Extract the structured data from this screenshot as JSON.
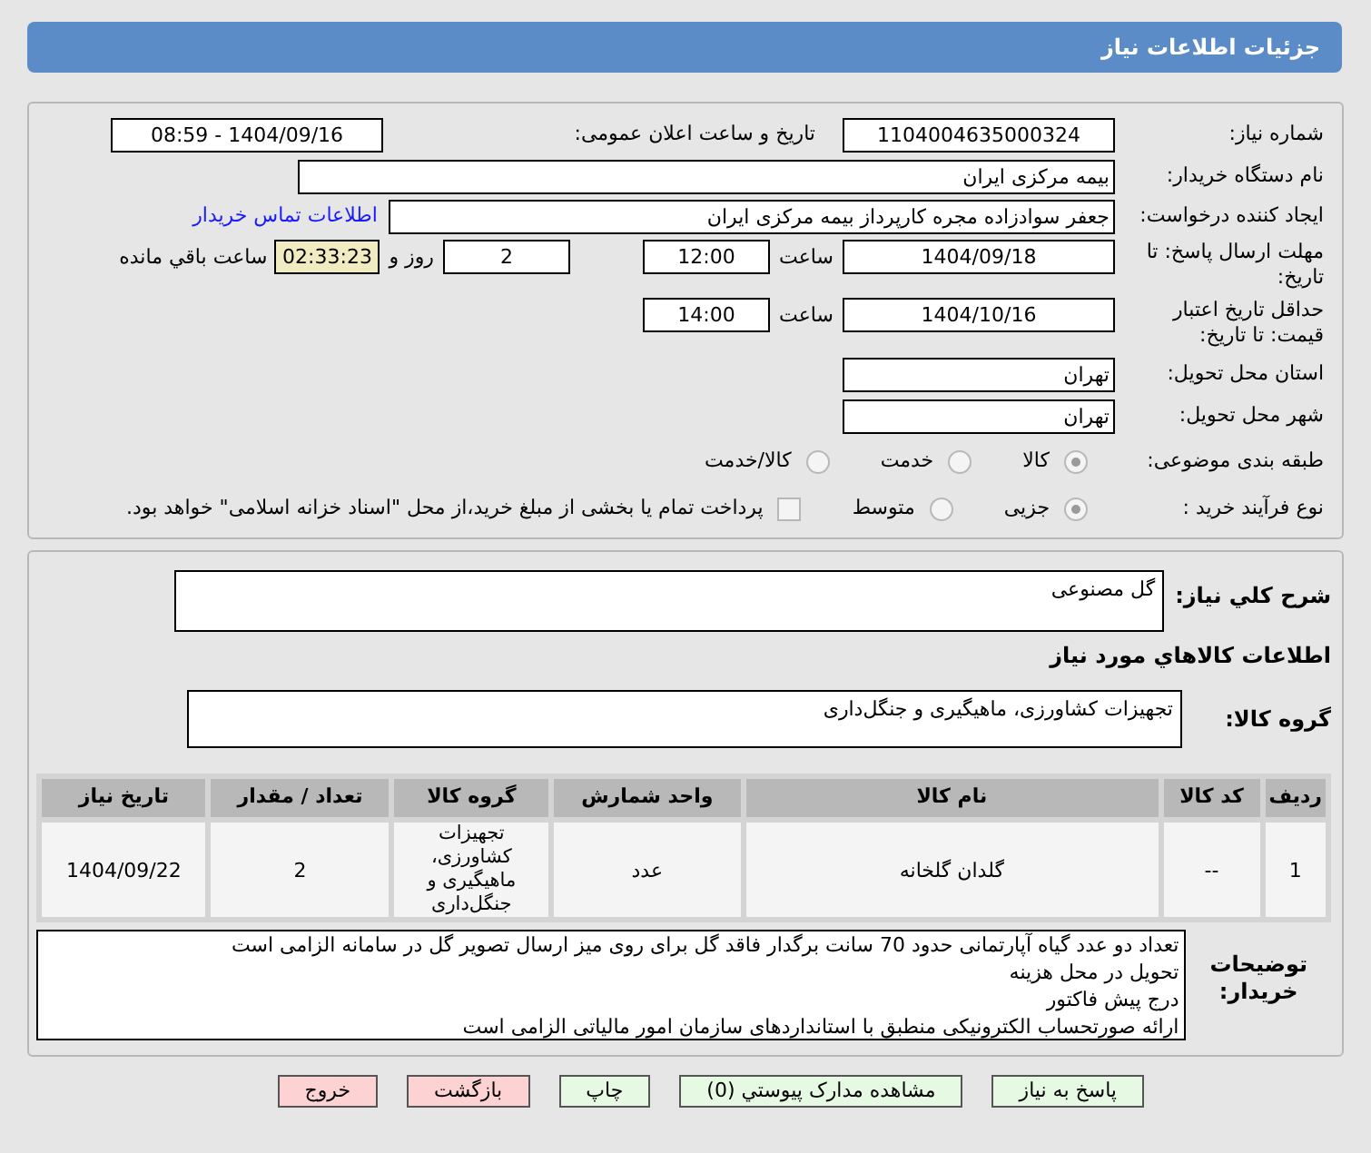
{
  "title": "جزئیات اطلاعات نیاز",
  "need_number": {
    "label": "شماره نیاز:",
    "value": "1104004635000324"
  },
  "announce": {
    "label": "تاریخ و ساعت اعلان عمومی:",
    "value": "1404/09/16 - 08:59"
  },
  "buyer_org": {
    "label": "نام دستگاه خریدار:",
    "value": "بیمه مرکزی ایران"
  },
  "requester": {
    "label": "ایجاد کننده درخواست:",
    "value": "جعفر سوادزاده مجره کارپرداز بیمه مرکزی ایران",
    "link": "اطلاعات تماس خریدار"
  },
  "deadline": {
    "label": "مهلت ارسال پاسخ: تا تاریخ:",
    "date": "1404/09/18",
    "time_label": "ساعت",
    "time": "12:00",
    "days": "2",
    "days_suffix": "روز و",
    "remaining": "02:33:23",
    "remaining_suffix": "ساعت باقي مانده"
  },
  "validity": {
    "label": "حداقل تاریخ اعتبار قیمت: تا تاریخ:",
    "date": "1404/10/16",
    "time_label": "ساعت",
    "time": "14:00"
  },
  "province": {
    "label": "استان محل تحویل:",
    "value": "تهران"
  },
  "city": {
    "label": "شهر محل تحویل:",
    "value": "تهران"
  },
  "category": {
    "label": "طبقه بندی موضوعی:",
    "options": [
      {
        "label": "کالا",
        "selected": true
      },
      {
        "label": "خدمت",
        "selected": false
      },
      {
        "label": "کالا/خدمت",
        "selected": false
      }
    ]
  },
  "process": {
    "label": "نوع فرآیند خرید :",
    "options": [
      {
        "label": "جزیی",
        "selected": true
      },
      {
        "label": "متوسط",
        "selected": false
      }
    ],
    "checkbox": {
      "checked": false,
      "label": "پرداخت تمام یا بخشی از مبلغ خرید،از محل \"اسناد خزانه اسلامی\" خواهد بود."
    }
  },
  "description": {
    "label": "شرح کلي نياز:",
    "value": "گل مصنوعی"
  },
  "goods_heading": "اطلاعات کالاهاي مورد نياز",
  "goods_group": {
    "label": "گروه کالا:",
    "value": "تجهیزات کشاورزی، ماهیگیری و جنگل‌داری"
  },
  "table": {
    "columns": [
      "ردیف",
      "کد کالا",
      "نام کالا",
      "واحد شمارش",
      "گروه کالا",
      "تعداد / مقدار",
      "تاریخ نیاز"
    ],
    "rows": [
      [
        "1",
        "--",
        "گلدان گلخانه",
        "عدد",
        "تجهیزات کشاورزی، ماهیگیری و جنگل‌داری",
        "2",
        "1404/09/22"
      ]
    ]
  },
  "buyer_notes": {
    "label": "توضیحات خریدار:",
    "lines": [
      "تعداد دو عدد گیاه آپارتمانی حدود 70 سانت برگدار فاقد گل برای روی میز ارسال تصویر گل در سامانه الزامی است",
      "تحویل در محل هزینه",
      "درج پیش فاکتور",
      "ارائه صورتحساب الکترونیکی منطبق با استانداردهای سازمان امور مالیاتی الزامی است"
    ]
  },
  "buttons": [
    {
      "label": "پاسخ به نیاز",
      "kind": "green"
    },
    {
      "label": "مشاهده مدارک پیوستي (0)",
      "kind": "green"
    },
    {
      "label": "چاپ",
      "kind": "green"
    },
    {
      "label": "بازگشت",
      "kind": "red"
    },
    {
      "label": "خروج",
      "kind": "red"
    }
  ]
}
